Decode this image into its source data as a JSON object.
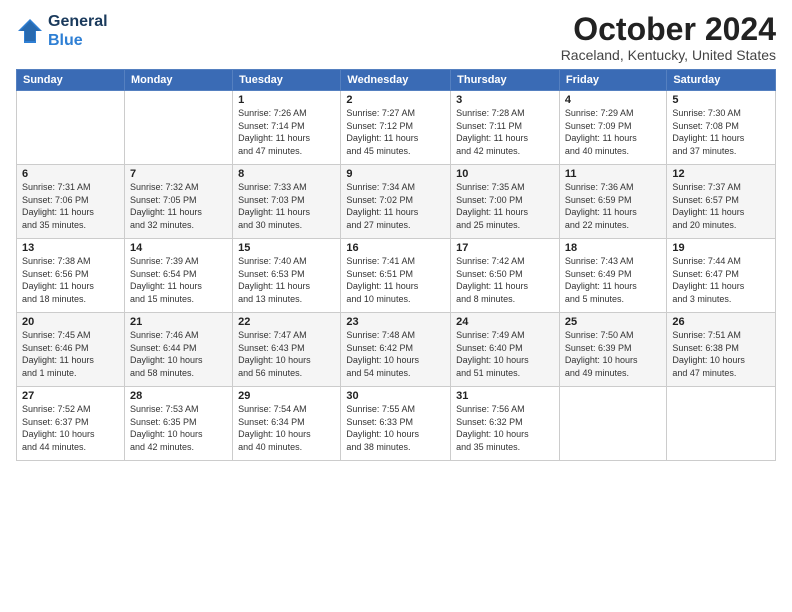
{
  "header": {
    "logo_line1": "General",
    "logo_line2": "Blue",
    "month": "October 2024",
    "location": "Raceland, Kentucky, United States"
  },
  "weekdays": [
    "Sunday",
    "Monday",
    "Tuesday",
    "Wednesday",
    "Thursday",
    "Friday",
    "Saturday"
  ],
  "weeks": [
    [
      {
        "day": "",
        "info": ""
      },
      {
        "day": "",
        "info": ""
      },
      {
        "day": "1",
        "info": "Sunrise: 7:26 AM\nSunset: 7:14 PM\nDaylight: 11 hours\nand 47 minutes."
      },
      {
        "day": "2",
        "info": "Sunrise: 7:27 AM\nSunset: 7:12 PM\nDaylight: 11 hours\nand 45 minutes."
      },
      {
        "day": "3",
        "info": "Sunrise: 7:28 AM\nSunset: 7:11 PM\nDaylight: 11 hours\nand 42 minutes."
      },
      {
        "day": "4",
        "info": "Sunrise: 7:29 AM\nSunset: 7:09 PM\nDaylight: 11 hours\nand 40 minutes."
      },
      {
        "day": "5",
        "info": "Sunrise: 7:30 AM\nSunset: 7:08 PM\nDaylight: 11 hours\nand 37 minutes."
      }
    ],
    [
      {
        "day": "6",
        "info": "Sunrise: 7:31 AM\nSunset: 7:06 PM\nDaylight: 11 hours\nand 35 minutes."
      },
      {
        "day": "7",
        "info": "Sunrise: 7:32 AM\nSunset: 7:05 PM\nDaylight: 11 hours\nand 32 minutes."
      },
      {
        "day": "8",
        "info": "Sunrise: 7:33 AM\nSunset: 7:03 PM\nDaylight: 11 hours\nand 30 minutes."
      },
      {
        "day": "9",
        "info": "Sunrise: 7:34 AM\nSunset: 7:02 PM\nDaylight: 11 hours\nand 27 minutes."
      },
      {
        "day": "10",
        "info": "Sunrise: 7:35 AM\nSunset: 7:00 PM\nDaylight: 11 hours\nand 25 minutes."
      },
      {
        "day": "11",
        "info": "Sunrise: 7:36 AM\nSunset: 6:59 PM\nDaylight: 11 hours\nand 22 minutes."
      },
      {
        "day": "12",
        "info": "Sunrise: 7:37 AM\nSunset: 6:57 PM\nDaylight: 11 hours\nand 20 minutes."
      }
    ],
    [
      {
        "day": "13",
        "info": "Sunrise: 7:38 AM\nSunset: 6:56 PM\nDaylight: 11 hours\nand 18 minutes."
      },
      {
        "day": "14",
        "info": "Sunrise: 7:39 AM\nSunset: 6:54 PM\nDaylight: 11 hours\nand 15 minutes."
      },
      {
        "day": "15",
        "info": "Sunrise: 7:40 AM\nSunset: 6:53 PM\nDaylight: 11 hours\nand 13 minutes."
      },
      {
        "day": "16",
        "info": "Sunrise: 7:41 AM\nSunset: 6:51 PM\nDaylight: 11 hours\nand 10 minutes."
      },
      {
        "day": "17",
        "info": "Sunrise: 7:42 AM\nSunset: 6:50 PM\nDaylight: 11 hours\nand 8 minutes."
      },
      {
        "day": "18",
        "info": "Sunrise: 7:43 AM\nSunset: 6:49 PM\nDaylight: 11 hours\nand 5 minutes."
      },
      {
        "day": "19",
        "info": "Sunrise: 7:44 AM\nSunset: 6:47 PM\nDaylight: 11 hours\nand 3 minutes."
      }
    ],
    [
      {
        "day": "20",
        "info": "Sunrise: 7:45 AM\nSunset: 6:46 PM\nDaylight: 11 hours\nand 1 minute."
      },
      {
        "day": "21",
        "info": "Sunrise: 7:46 AM\nSunset: 6:44 PM\nDaylight: 10 hours\nand 58 minutes."
      },
      {
        "day": "22",
        "info": "Sunrise: 7:47 AM\nSunset: 6:43 PM\nDaylight: 10 hours\nand 56 minutes."
      },
      {
        "day": "23",
        "info": "Sunrise: 7:48 AM\nSunset: 6:42 PM\nDaylight: 10 hours\nand 54 minutes."
      },
      {
        "day": "24",
        "info": "Sunrise: 7:49 AM\nSunset: 6:40 PM\nDaylight: 10 hours\nand 51 minutes."
      },
      {
        "day": "25",
        "info": "Sunrise: 7:50 AM\nSunset: 6:39 PM\nDaylight: 10 hours\nand 49 minutes."
      },
      {
        "day": "26",
        "info": "Sunrise: 7:51 AM\nSunset: 6:38 PM\nDaylight: 10 hours\nand 47 minutes."
      }
    ],
    [
      {
        "day": "27",
        "info": "Sunrise: 7:52 AM\nSunset: 6:37 PM\nDaylight: 10 hours\nand 44 minutes."
      },
      {
        "day": "28",
        "info": "Sunrise: 7:53 AM\nSunset: 6:35 PM\nDaylight: 10 hours\nand 42 minutes."
      },
      {
        "day": "29",
        "info": "Sunrise: 7:54 AM\nSunset: 6:34 PM\nDaylight: 10 hours\nand 40 minutes."
      },
      {
        "day": "30",
        "info": "Sunrise: 7:55 AM\nSunset: 6:33 PM\nDaylight: 10 hours\nand 38 minutes."
      },
      {
        "day": "31",
        "info": "Sunrise: 7:56 AM\nSunset: 6:32 PM\nDaylight: 10 hours\nand 35 minutes."
      },
      {
        "day": "",
        "info": ""
      },
      {
        "day": "",
        "info": ""
      }
    ]
  ]
}
